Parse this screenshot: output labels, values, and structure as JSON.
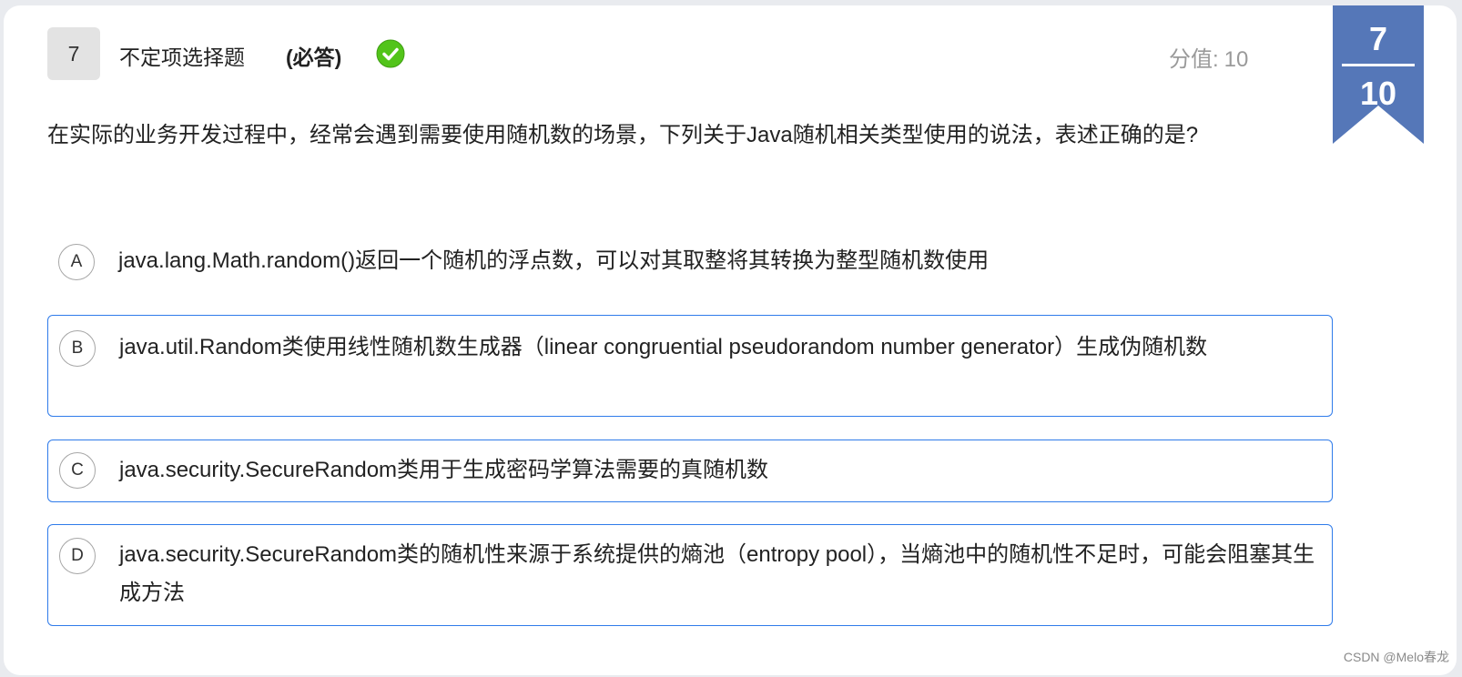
{
  "question": {
    "number": "7",
    "type_label": "不定项选择题",
    "required_label": "(必答)",
    "score_label": "分值:",
    "score_value": "10",
    "text": "在实际的业务开发过程中，经常会遇到需要使用随机数的场景，下列关于Java随机相关类型使用的说法，表述正确的是?"
  },
  "progress": {
    "current": "7",
    "total": "10"
  },
  "options": [
    {
      "letter": "A",
      "text": "java.lang.Math.random()返回一个随机的浮点数，可以对其取整将其转换为整型随机数使用",
      "selected": false
    },
    {
      "letter": "B",
      "text": "java.util.Random类使用线性随机数生成器（linear congruential pseudorandom number generator）生成伪随机数",
      "selected": true
    },
    {
      "letter": "C",
      "text": "java.security.SecureRandom类用于生成密码学算法需要的真随机数",
      "selected": true
    },
    {
      "letter": "D",
      "text": "java.security.SecureRandom类的随机性来源于系统提供的熵池（entropy pool），当熵池中的随机性不足时，可能会阻塞其生成方法",
      "selected": true
    }
  ],
  "watermark": "CSDN @Melo春龙",
  "colors": {
    "ribbon": "#5577b8",
    "selected_border": "#2f7bea",
    "check_green": "#52c41a"
  },
  "icons": {
    "answered": "check-circle-icon"
  }
}
